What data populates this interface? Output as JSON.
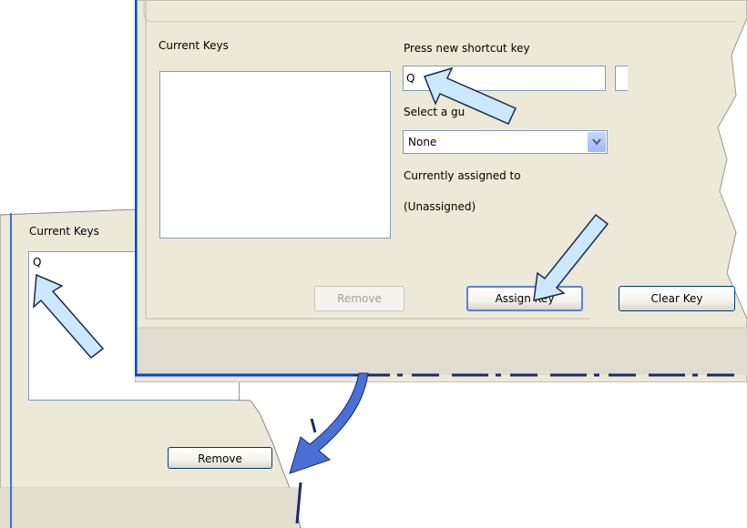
{
  "back_dialog": {
    "current_keys_label": "Current Keys",
    "keys_list_items": [
      "Q"
    ],
    "remove_label": "Remove"
  },
  "front_dialog": {
    "current_keys_label": "Current Keys",
    "press_shortcut_label": "Press new shortcut key",
    "shortcut_value": "Q",
    "select_label": "Select a gu",
    "combo_value": "None",
    "currently_assigned_label": "Currently assigned to",
    "currently_assigned_value": "(Unassigned)",
    "remove_label": "Remove",
    "assign_label": "Assign Key",
    "clear_label": "Clear Key"
  },
  "annotations": {
    "arrow_color": "#cce8ff",
    "arrow_outline": "#1e2a4a",
    "curve_arrow_color": "#4a6fd6",
    "icons": [
      "callout-arrow-icon",
      "curved-transition-arrow-icon"
    ]
  },
  "colors": {
    "dialog_bg": "#ece9d8",
    "window_border": "#0046d5",
    "field_border": "#7f9db9"
  }
}
